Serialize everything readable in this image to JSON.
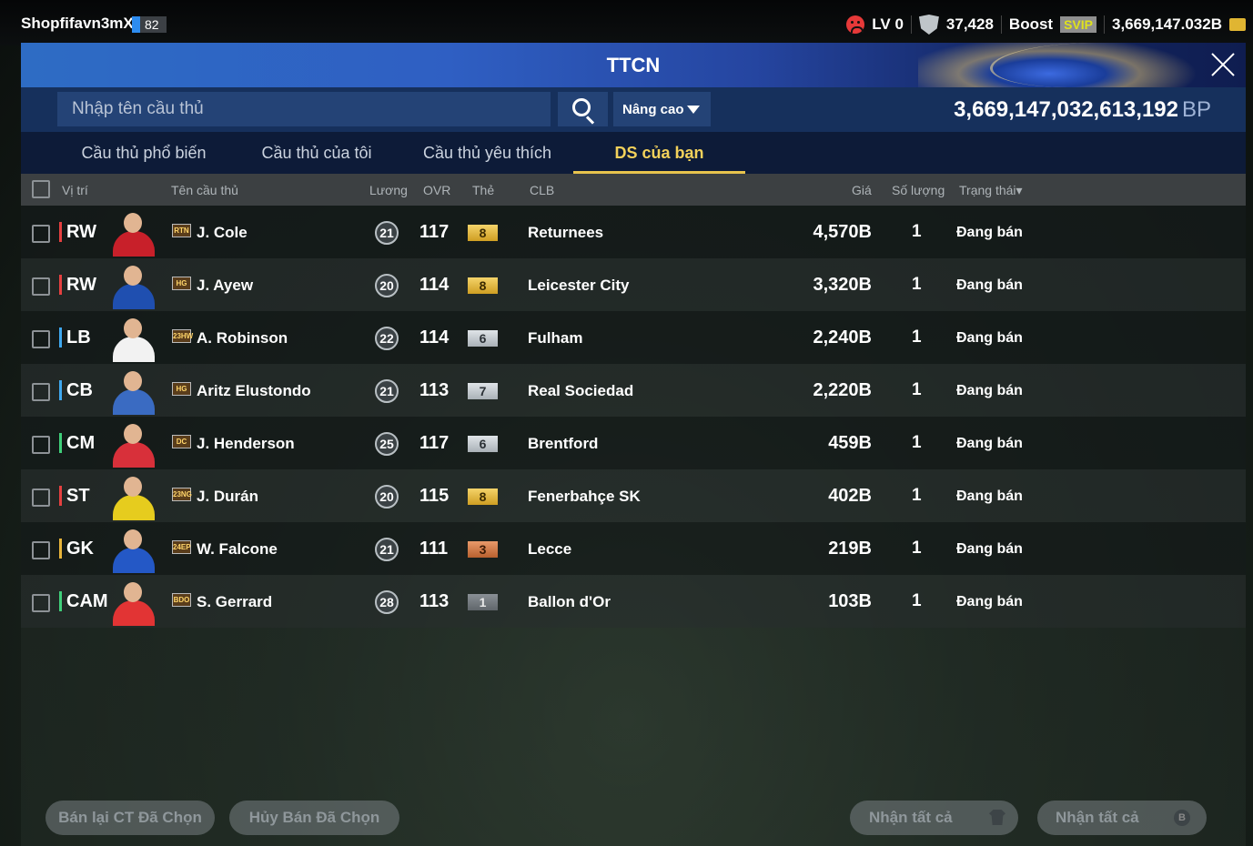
{
  "topbar": {
    "username": "Shopfifavn3mXr",
    "user_level": "82",
    "rank_label": "LV 0",
    "points": "37,428",
    "boost_label": "Boost",
    "svip_label": "SVIP",
    "currency": "3,669,147.032B"
  },
  "window": {
    "title": "TTCN",
    "search_placeholder": "Nhập tên cầu thủ",
    "advanced_label": "Nâng cao",
    "balance_value": "3,669,147,032,613,192",
    "balance_unit": "BP"
  },
  "tabs": [
    {
      "label": "Cầu thủ phổ biến",
      "active": false
    },
    {
      "label": "Cầu thủ của tôi",
      "active": false
    },
    {
      "label": "Cầu thủ yêu thích",
      "active": false
    },
    {
      "label": "DS của bạn",
      "active": true
    }
  ],
  "columns": {
    "position": "Vị trí",
    "name": "Tên cầu thủ",
    "wage": "Lương",
    "ovr": "OVR",
    "grade": "Thẻ",
    "club": "CLB",
    "price": "Giá",
    "quantity": "Số lượng",
    "status": "Trạng thái▾"
  },
  "players": [
    {
      "pos": "RW",
      "pos_group": "att",
      "season": "RTN",
      "name": "J. Cole",
      "wage": "21",
      "ovr": "117",
      "grade": "8",
      "grade_tier": "gold",
      "club": "Returnees",
      "price": "4,570B",
      "qty": "1",
      "status": "Đang bán",
      "kit_color": "#c8202a"
    },
    {
      "pos": "RW",
      "pos_group": "att",
      "season": "HG",
      "name": "J. Ayew",
      "wage": "20",
      "ovr": "114",
      "grade": "8",
      "grade_tier": "gold",
      "club": "Leicester City",
      "price": "3,320B",
      "qty": "1",
      "status": "Đang bán",
      "kit_color": "#1f4fb0"
    },
    {
      "pos": "LB",
      "pos_group": "def",
      "season": "23HW",
      "name": "A. Robinson",
      "wage": "22",
      "ovr": "114",
      "grade": "6",
      "grade_tier": "silver",
      "club": "Fulham",
      "price": "2,240B",
      "qty": "1",
      "status": "Đang bán",
      "kit_color": "#f2f2f2"
    },
    {
      "pos": "CB",
      "pos_group": "def",
      "season": "HG",
      "name": "Aritz Elustondo",
      "wage": "21",
      "ovr": "113",
      "grade": "7",
      "grade_tier": "silver",
      "club": "Real Sociedad",
      "price": "2,220B",
      "qty": "1",
      "status": "Đang bán",
      "kit_color": "#3a6bc2"
    },
    {
      "pos": "CM",
      "pos_group": "mid",
      "season": "DC",
      "name": "J. Henderson",
      "wage": "25",
      "ovr": "117",
      "grade": "6",
      "grade_tier": "silver",
      "club": "Brentford",
      "price": "459B",
      "qty": "1",
      "status": "Đang bán",
      "kit_color": "#d8303a"
    },
    {
      "pos": "ST",
      "pos_group": "att",
      "season": "23NG",
      "name": "J. Durán",
      "wage": "20",
      "ovr": "115",
      "grade": "8",
      "grade_tier": "gold",
      "club": "Fenerbahçe SK",
      "price": "402B",
      "qty": "1",
      "status": "Đang bán",
      "kit_color": "#e6cc1e"
    },
    {
      "pos": "GK",
      "pos_group": "gk",
      "season": "24EP",
      "name": "W. Falcone",
      "wage": "21",
      "ovr": "111",
      "grade": "3",
      "grade_tier": "bronze",
      "club": "Lecce",
      "price": "219B",
      "qty": "1",
      "status": "Đang bán",
      "kit_color": "#2458c6"
    },
    {
      "pos": "CAM",
      "pos_group": "mid",
      "season": "BDO",
      "name": "S. Gerrard",
      "wage": "28",
      "ovr": "113",
      "grade": "1",
      "grade_tier": "grey",
      "club": "Ballon d'Or",
      "price": "103B",
      "qty": "1",
      "status": "Đang bán",
      "kit_color": "#e23434"
    }
  ],
  "footer": {
    "resell_label": "Bán lại CT Đã Chọn",
    "cancel_label": "Hủy Bán Đã Chọn",
    "claim_all_label_1": "Nhận tất cả",
    "claim_all_label_2": "Nhận tất cả"
  },
  "icons": {
    "rank": "sad-face-icon",
    "points": "shield-icon",
    "currency": "coin-icon",
    "search": "search-icon",
    "close": "close-icon",
    "dropdown": "chevron-down-icon",
    "claim_1": "shirt-icon",
    "claim_2": "bp-coin-icon"
  }
}
